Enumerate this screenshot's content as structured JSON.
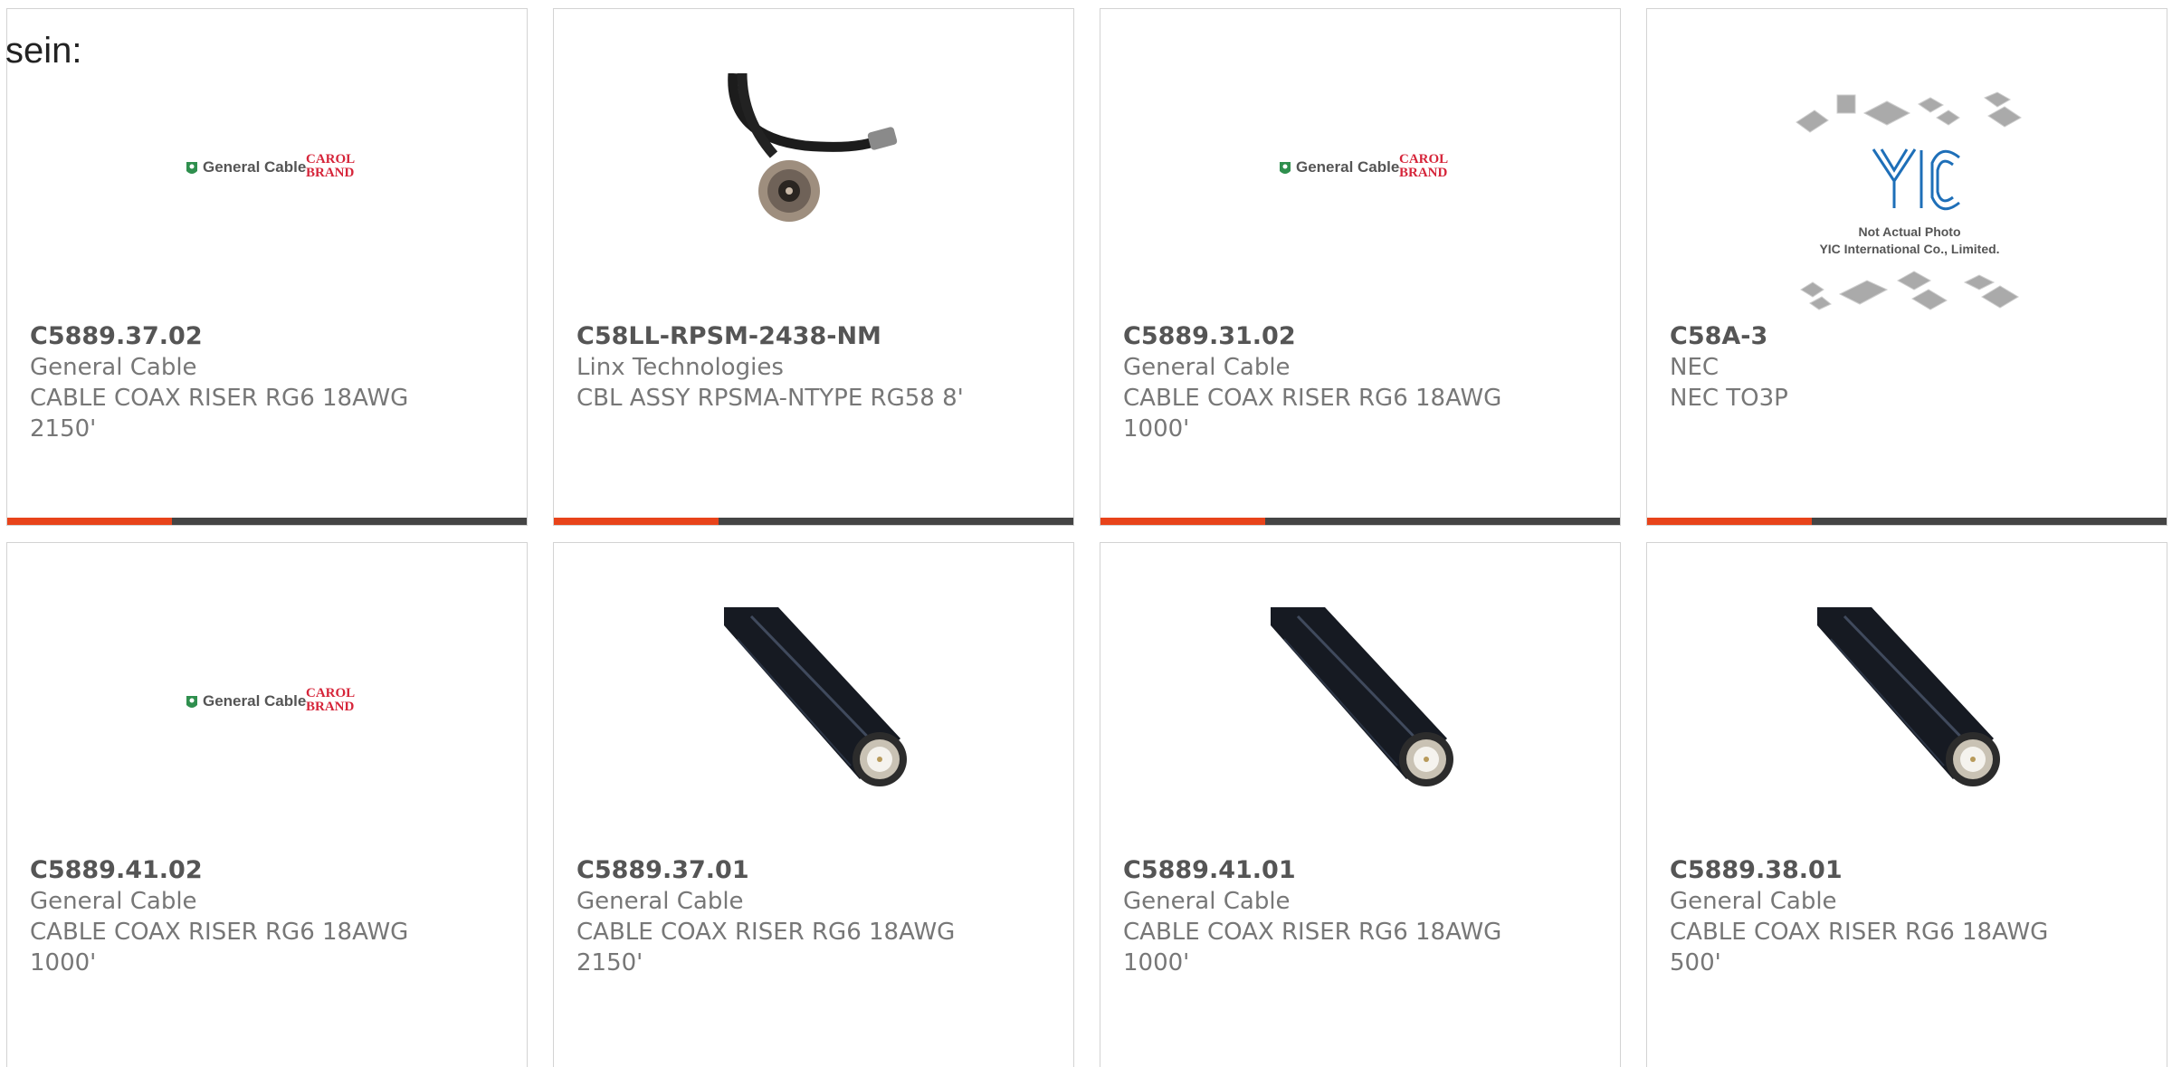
{
  "intro_text": "sein:",
  "products": [
    {
      "part_number": "C5889.37.02",
      "manufacturer": "General Cable",
      "description": "CABLE COAX RISER RG6 18AWG 2150'",
      "image": "general-cable-logo"
    },
    {
      "part_number": "C58LL-RPSM-2438-NM",
      "manufacturer": "Linx Technologies",
      "description": "CBL ASSY RPSMA-NTYPE RG58 8'",
      "image": "cable-assembly-photo"
    },
    {
      "part_number": "C5889.31.02",
      "manufacturer": "General Cable",
      "description": "CABLE COAX RISER RG6 18AWG 1000'",
      "image": "general-cable-logo"
    },
    {
      "part_number": "C58A-3",
      "manufacturer": "NEC",
      "description": "NEC TO3P",
      "image": "placeholder-photo",
      "placeholder": {
        "line1": "Not Actual Photo",
        "line2": "YIC International Co., Limited."
      }
    },
    {
      "part_number": "C5889.41.02",
      "manufacturer": "General Cable",
      "description": "CABLE COAX RISER RG6 18AWG 1000'",
      "image": "general-cable-logo"
    },
    {
      "part_number": "C5889.37.01",
      "manufacturer": "General Cable",
      "description": "CABLE COAX RISER RG6 18AWG 2150'",
      "image": "coax-cable-photo"
    },
    {
      "part_number": "C5889.41.01",
      "manufacturer": "General Cable",
      "description": "CABLE COAX RISER RG6 18AWG 1000'",
      "image": "coax-cable-photo"
    },
    {
      "part_number": "C5889.38.01",
      "manufacturer": "General Cable",
      "description": "CABLE COAX RISER RG6 18AWG 500'",
      "image": "coax-cable-photo"
    }
  ],
  "logo": {
    "brand": "General Cable",
    "sub_top": "CAROL",
    "sub_bottom": "BRAND"
  },
  "colors": {
    "accent": "#e8431a",
    "bar": "#444444",
    "logo_green": "#2f8f4e",
    "logo_red": "#d6253a"
  }
}
